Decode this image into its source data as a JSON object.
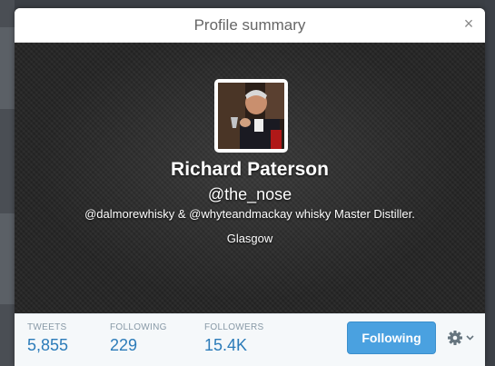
{
  "modal": {
    "title": "Profile summary",
    "close_glyph": "×"
  },
  "profile": {
    "name": "Richard Paterson",
    "handle": "@the_nose",
    "bio": "@dalmorewhisky & @whyteandmackay whisky Master Distiller.",
    "location": "Glasgow"
  },
  "stats": [
    {
      "label": "TWEETS",
      "value": "5,855"
    },
    {
      "label": "FOLLOWING",
      "value": "229"
    },
    {
      "label": "FOLLOWERS",
      "value": "15.4K"
    }
  ],
  "actions": {
    "follow_label": "Following",
    "settings_icon": "gear-icon",
    "dropdown_icon": "chevron-down-icon"
  },
  "colors": {
    "accent": "#4aa1e0",
    "stat_value": "#2b7bb9",
    "header_bg": "#252525"
  }
}
